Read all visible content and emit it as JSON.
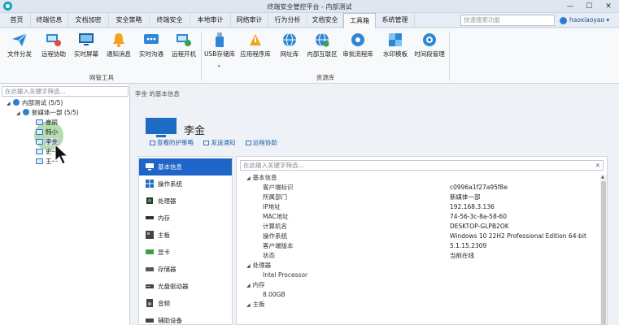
{
  "window": {
    "title": "终端安全管控平台 - 内部测试",
    "controls": [
      "—",
      "☐",
      "✕"
    ]
  },
  "menu": {
    "tabs": [
      "首页",
      "终端信息",
      "文档加密",
      "安全策略",
      "终端安全",
      "本地审计",
      "网络审计",
      "行为分析",
      "文档安全",
      "工具箱",
      "系统管理"
    ],
    "active_tab": "工具箱",
    "search_placeholder": "快速搜索功能",
    "user": "haoxiaoyao"
  },
  "ribbon": {
    "groups": [
      {
        "label": "网管工具",
        "buttons": [
          "文件分发",
          "远程协助",
          "实时屏幕",
          "通知消息",
          "实时沟通",
          "远程开机"
        ]
      },
      {
        "label": "资源库",
        "buttons": [
          "USB存储库",
          "应用程序库",
          "网址库",
          "内部互联区",
          "审批流程库",
          "水印模板",
          "时间段管理"
        ]
      }
    ],
    "usb_dropdown": "▾"
  },
  "tree": {
    "search_placeholder": "在此输入关键字筛选...",
    "root": "内部测试 (5/5)",
    "group": "新媒体一部 (5/5)",
    "computers": [
      "崔丽",
      "韩小",
      "李金",
      "史一",
      "王一"
    ],
    "selected": "李金"
  },
  "breadcrumb": "李金 的基本信息",
  "host": {
    "name": "李金",
    "links": [
      "查看防护策略",
      "发送通知",
      "远程协助"
    ]
  },
  "nav": {
    "items": [
      "基本信息",
      "操作系统",
      "处理器",
      "内存",
      "主板",
      "显卡",
      "存储器",
      "光盘驱动器",
      "音频",
      "辅助设备"
    ],
    "active": "基本信息"
  },
  "detail": {
    "search_placeholder": "在此输入关键字筛选...",
    "section_basic": "基本信息",
    "fields": [
      {
        "k": "客户端标识",
        "v": "c0996a1f27a95f8e"
      },
      {
        "k": "所属部门",
        "v": "新媒体一部"
      },
      {
        "k": "IP地址",
        "v": "192.168.3.136"
      },
      {
        "k": "MAC地址",
        "v": "74-56-3c-8a-58-60"
      },
      {
        "k": "计算机名",
        "v": "DESKTOP-GLPB2OK"
      },
      {
        "k": "操作系统",
        "v": "Windows 10 22H2 Professional Edition 64-bit"
      },
      {
        "k": "客户端版本",
        "v": "5.1.15.2309"
      },
      {
        "k": "状态",
        "v": "当前在线"
      }
    ],
    "section_cpu": "处理器",
    "cpu_value": "Intel Processor",
    "section_mem": "内存",
    "mem_value": "8.00GB",
    "section_board": "主板"
  }
}
